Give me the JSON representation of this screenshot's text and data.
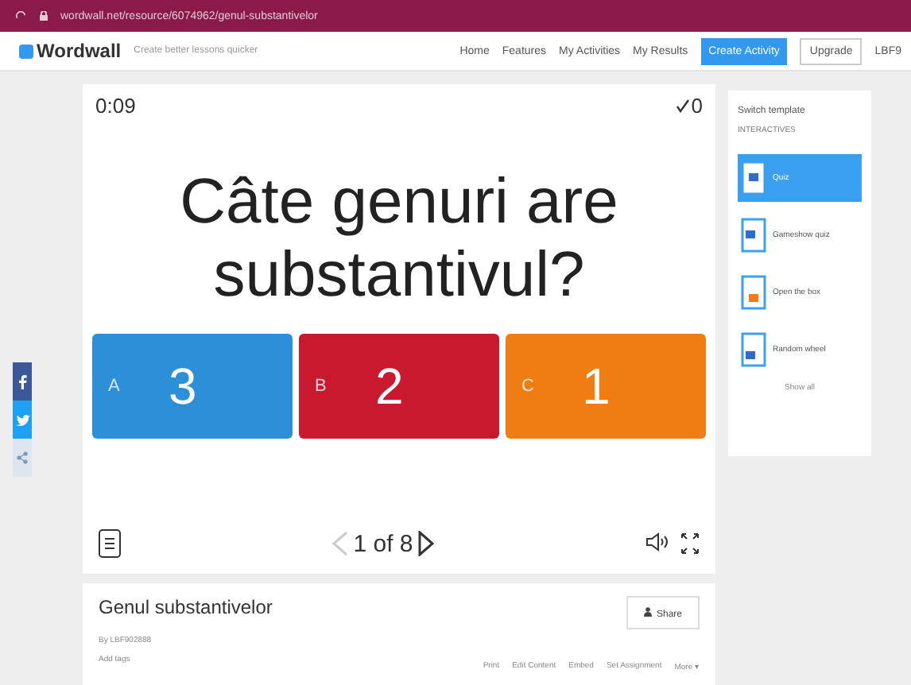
{
  "browser": {
    "url": "wordwall.net/resource/6074962/genul-substantivelor"
  },
  "header": {
    "logo": "Wordwall",
    "tagline": "Create better lessons quicker",
    "nav": [
      "Home",
      "Features",
      "My Activities",
      "My Results"
    ],
    "create_button": "Create Activity",
    "upgrade_button": "Upgrade",
    "user": "LBF9"
  },
  "game": {
    "timer": "0:09",
    "score": "0",
    "question": "Câte genuri are substantivul?",
    "answers": [
      {
        "letter": "A",
        "text": "3",
        "color": "#2d8fd8"
      },
      {
        "letter": "B",
        "text": "2",
        "color": "#c8192e"
      },
      {
        "letter": "C",
        "text": "1",
        "color": "#f07d14"
      }
    ],
    "page": "1 of 8"
  },
  "social": [
    {
      "kind": "facebook",
      "color": "#3b5998"
    },
    {
      "kind": "twitter",
      "color": "#1da1f2"
    },
    {
      "kind": "share",
      "color": "#dde6ee"
    }
  ],
  "activity": {
    "title": "Genul substantivelor",
    "author": "By LBF902888",
    "tags": "Add tags",
    "share": "Share",
    "actions": [
      "Print",
      "Edit Content",
      "Embed",
      "Set Assignment",
      "More ▾"
    ]
  },
  "templates": {
    "title": "Switch template",
    "section": "INTERACTIVES",
    "items": [
      {
        "label": "Quiz",
        "selected": true
      },
      {
        "label": "Gameshow quiz",
        "selected": false
      },
      {
        "label": "Open the box",
        "selected": false
      },
      {
        "label": "Random wheel",
        "selected": false
      }
    ],
    "show_all": "Show all"
  }
}
